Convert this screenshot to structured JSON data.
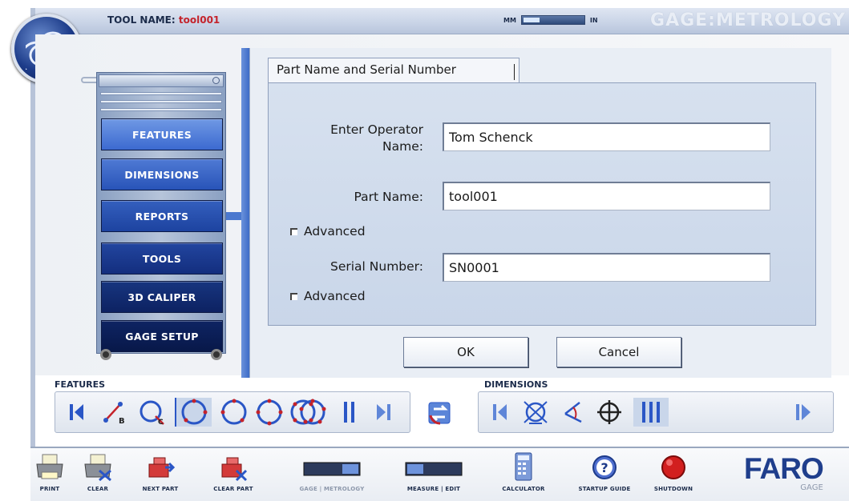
{
  "header": {
    "tool_name_label": "TOOL NAME:",
    "tool_name_value": "tool001",
    "unit_left": "MM",
    "unit_right": "IN",
    "mode_title": "GAGE:METROLOGY"
  },
  "sidebar": {
    "items": [
      {
        "label": "FEATURES"
      },
      {
        "label": "DIMENSIONS"
      },
      {
        "label": "REPORTS"
      },
      {
        "label": "TOOLS"
      },
      {
        "label": "3D CALIPER"
      },
      {
        "label": "GAGE SETUP"
      }
    ]
  },
  "dialog": {
    "tab_title": "Part Name and Serial Number",
    "operator_label_line1": "Enter Operator",
    "operator_label_line2": "Name:",
    "operator_value": "Tom Schenck",
    "part_label": "Part Name:",
    "part_value": "tool001",
    "part_advanced": "Advanced",
    "serial_label": "Serial Number:",
    "serial_value": "SN0001",
    "serial_advanced": "Advanced",
    "ok_label": "OK",
    "cancel_label": "Cancel"
  },
  "features_strip": {
    "label": "FEATURES",
    "icons": [
      "prev-icon",
      "distance-icon",
      "circle-icon",
      "cylinder-icon",
      "circle-point-icon",
      "circle-3pt-icon",
      "circle-4pt-icon",
      "circle-5pt-icon",
      "pause-icon",
      "next-icon"
    ]
  },
  "swap_icon": "swap-icon",
  "dimensions_strip": {
    "label": "DIMENSIONS",
    "icons": [
      "prev-icon",
      "circle-dimension-icon",
      "angle-icon",
      "position-icon",
      "more-icon",
      "next-icon"
    ]
  },
  "toolbar": {
    "items": [
      {
        "label": "PRINT",
        "icon": "printer-icon"
      },
      {
        "label": "CLEAR",
        "icon": "clear-printer-icon"
      },
      {
        "label": "NEXT PART",
        "icon": "next-part-icon"
      },
      {
        "label": "CLEAR PART",
        "icon": "clear-part-icon"
      },
      {
        "label": "GAGE | METROLOGY",
        "icon": "gage-metrology-toggle"
      },
      {
        "label": "MEASURE | EDIT",
        "icon": "measure-edit-toggle"
      },
      {
        "label": "CALCULATOR",
        "icon": "calculator-icon"
      },
      {
        "label": "STARTUP GUIDE",
        "icon": "help-icon"
      },
      {
        "label": "SHUTDOWN",
        "icon": "shutdown-icon"
      }
    ],
    "brand": "FARO",
    "brand_sub": "GAGE"
  },
  "colors": {
    "accent_blue": "#3c6ad0",
    "header_red": "#c4232b",
    "brand_blue": "#1f3e8c"
  }
}
